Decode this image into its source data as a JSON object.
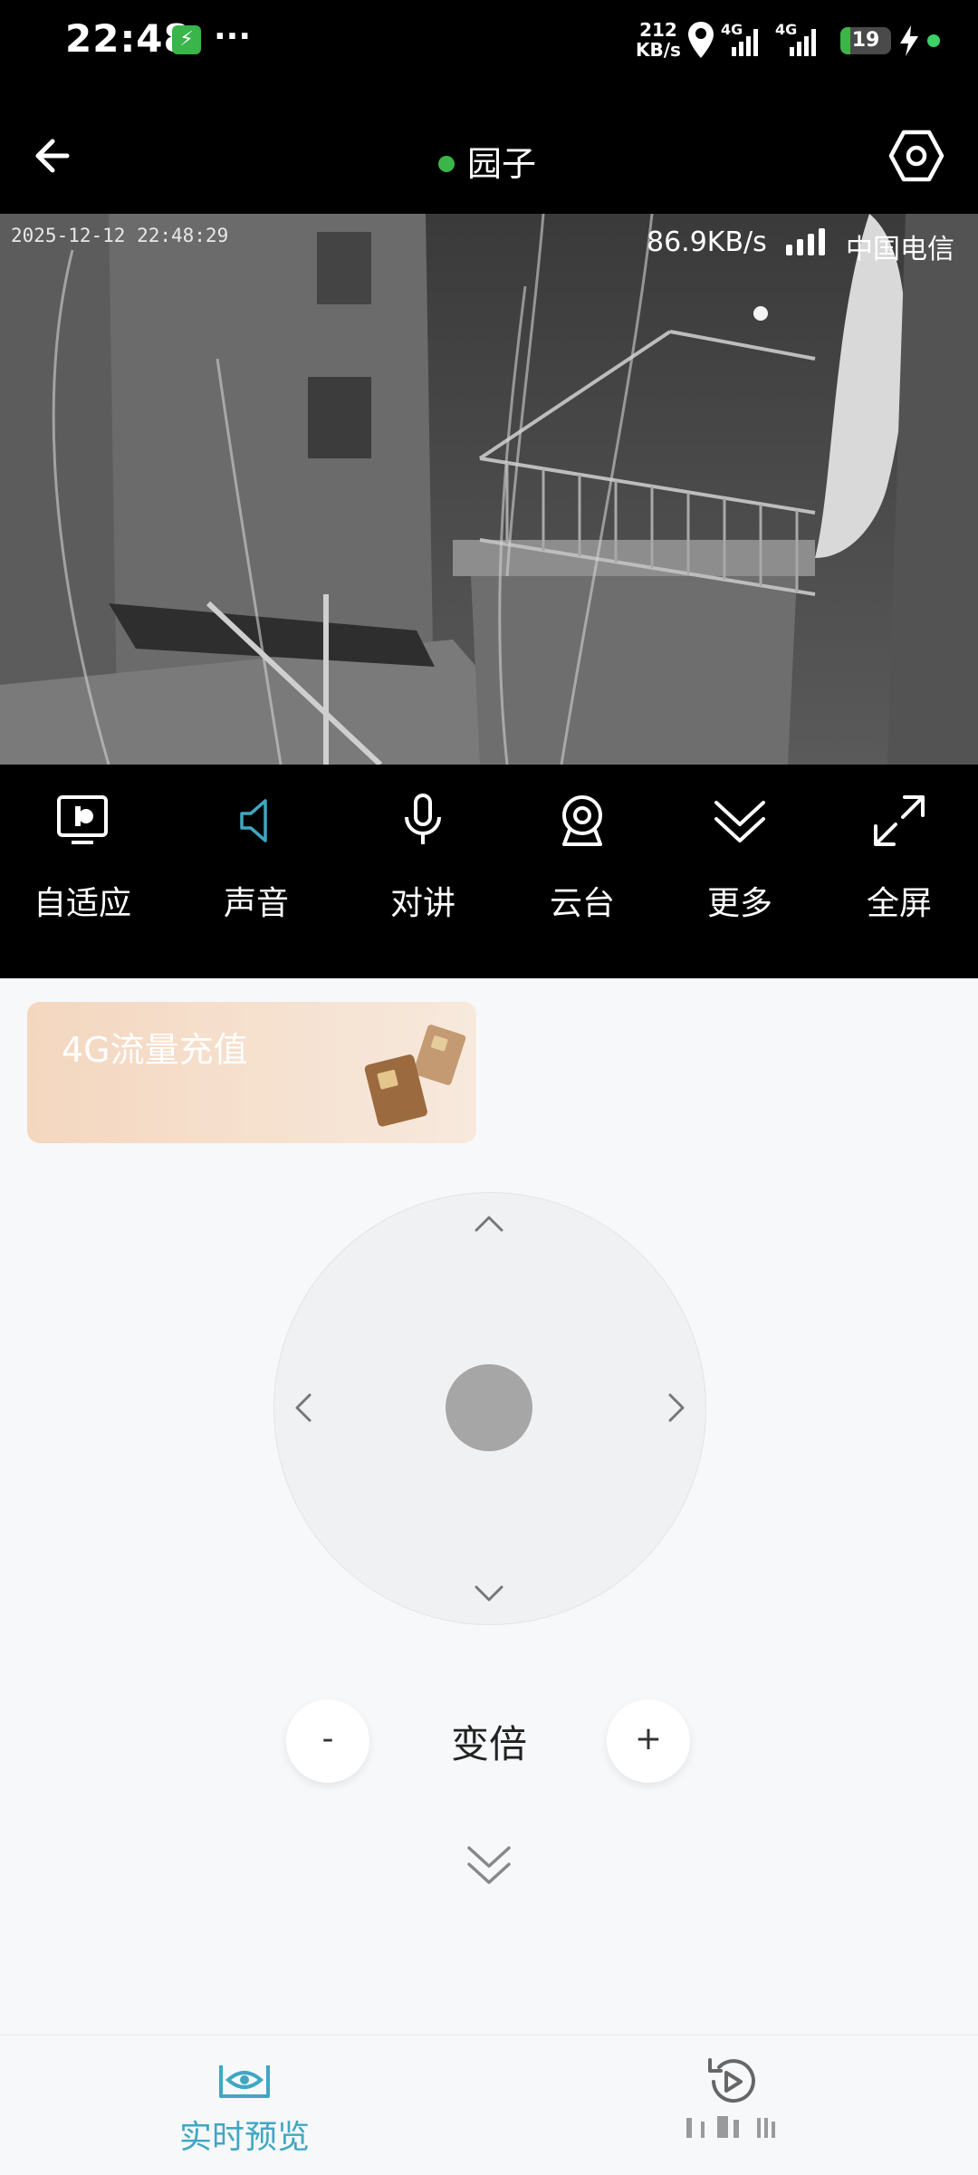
{
  "status_bar": {
    "time": "22:48",
    "net_speed_value": "212",
    "net_speed_unit": "KB/s",
    "battery_level": "19",
    "network_1": "4G",
    "network_2": "4G"
  },
  "header": {
    "title": "园子",
    "online_color": "#3bb54a"
  },
  "video": {
    "timestamp": "2025-12-12 22:48:29",
    "bitrate": "86.9KB/s",
    "carrier": "中国电信"
  },
  "controls": [
    {
      "label": "自适应",
      "icon": "adaptive-display-icon"
    },
    {
      "label": "声音",
      "icon": "speaker-icon"
    },
    {
      "label": "对讲",
      "icon": "microphone-icon"
    },
    {
      "label": "云台",
      "icon": "ptz-camera-icon"
    },
    {
      "label": "更多",
      "icon": "chevron-double-down-icon"
    },
    {
      "label": "全屏",
      "icon": "fullscreen-icon"
    }
  ],
  "promo": {
    "text": "4G流量充值"
  },
  "ptz": {
    "zoom_label": "变倍",
    "zoom_minus": "-",
    "zoom_plus": "+"
  },
  "bottom_nav": {
    "live_label": "实时预览",
    "accent_color": "#3fa7c2"
  }
}
